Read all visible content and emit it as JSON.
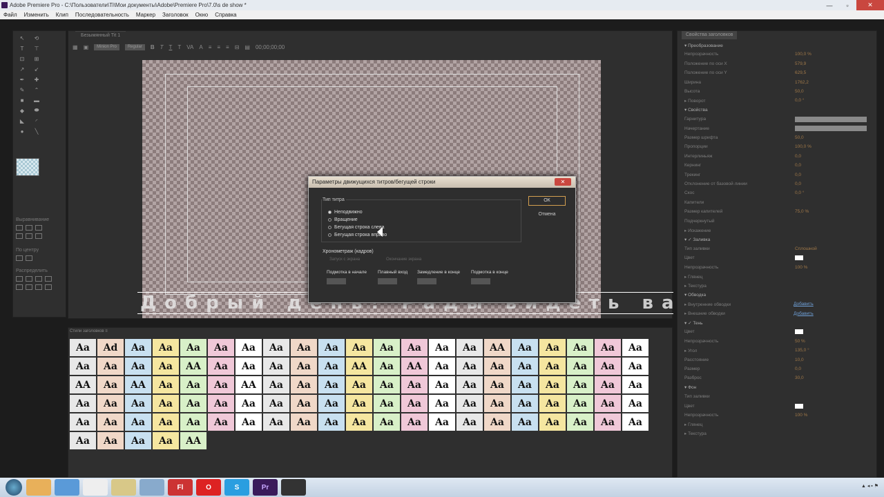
{
  "window": {
    "title": "Adobe Premiere Pro - C:\\Пользователи\\Ti\\Мои документы\\Adobe\\Premiere Pro\\7.0\\s de show *"
  },
  "menu": [
    "Файл",
    "Изменить",
    "Клип",
    "Последовательность",
    "Маркер",
    "Заголовок",
    "Окно",
    "Справка"
  ],
  "titler": {
    "tab": "Безымянный Tit 1",
    "font_box": "Minion Pro",
    "style_box": "Regular",
    "timecode": "00;00;00;00",
    "crawl_text": "Добрый день! Рады видеть вас в нашем н"
  },
  "tools_panel": {
    "align_label": "Выравнивание",
    "center_label": "По центру",
    "distribute_label": "Распределить"
  },
  "styles": {
    "tab": "Стили заголовков ≡"
  },
  "style_samples": [
    "Aa",
    "Ad",
    "Aa",
    "Aa",
    "Aa",
    "Aa",
    "Aa",
    "Aa",
    "Aa",
    "Aa",
    "Aa",
    "Aa",
    "Aa",
    "Aa",
    "Aa",
    "AA",
    "Aa",
    "Aa",
    "Aa",
    "Aa",
    "Aa",
    "Aa",
    "Aa",
    "Aa",
    "Aa",
    "AA",
    "Aa",
    "Aa",
    "Aa",
    "Aa",
    "Aa",
    "AA",
    "Aa",
    "AA",
    "Aa",
    "Aa",
    "Aa",
    "Aa",
    "Aa",
    "Aa",
    "Aa",
    "Aa",
    "AA",
    "Aa",
    "AA",
    "Aa",
    "Aa",
    "Aa",
    "AA",
    "Aa",
    "Aa",
    "Aa",
    "Aa",
    "Aa",
    "Aa",
    "Aa",
    "Aa",
    "Aa",
    "Aa",
    "Aa",
    "Aa",
    "Aa",
    "Aa",
    "Aa",
    "Aa",
    "Aa",
    "Aa",
    "Aa",
    "Aa",
    "Aa",
    "Aa",
    "Aa",
    "Aa",
    "Aa",
    "Aa",
    "Aa",
    "Aa",
    "Aa",
    "Aa",
    "Aa",
    "Aa",
    "Aa",
    "Aa",
    "Aa",
    "Aa",
    "Aa",
    "Aa",
    "Aa",
    "Aa",
    "Aa",
    "Aa",
    "Aa",
    "Aa",
    "Aa",
    "Aa",
    "Aa",
    "Aa",
    "Aa",
    "Aa",
    "Aa",
    "Aa",
    "Aa",
    "Aa",
    "Aa",
    "Aa",
    "Aa",
    "Aa",
    "Aa",
    "Aa",
    "AA"
  ],
  "properties": {
    "tab": "Свойства заголовков",
    "rows": [
      {
        "k": "▾ Преобразование",
        "v": "",
        "sec": true
      },
      {
        "k": "Непрозрачность",
        "v": "100,0 %"
      },
      {
        "k": "Положение по оси X",
        "v": "579,9"
      },
      {
        "k": "Положение по оси Y",
        "v": "629,5"
      },
      {
        "k": "Ширина",
        "v": "1762,2"
      },
      {
        "k": "Высота",
        "v": "50,0"
      },
      {
        "k": "▸ Поворот",
        "v": "0,0 °"
      },
      {
        "k": "▾ Свойства",
        "v": "",
        "sec": true
      },
      {
        "k": "Гарнитура",
        "bar": true
      },
      {
        "k": "Начертание",
        "bar": true
      },
      {
        "k": "Размер шрифта",
        "v": "50,0"
      },
      {
        "k": "Пропорции",
        "v": "100,0 %"
      },
      {
        "k": "Интерлиньяж",
        "v": "0,0"
      },
      {
        "k": "Кернинг",
        "v": "0,0"
      },
      {
        "k": "Трекинг",
        "v": "0,0"
      },
      {
        "k": "Отклонение от базовой линии",
        "v": "0,0"
      },
      {
        "k": "Скос",
        "v": "0,0 °"
      },
      {
        "k": "Капители",
        "v": ""
      },
      {
        "k": "Размер капителей",
        "v": "75,0 %"
      },
      {
        "k": "Подчеркнутый",
        "v": ""
      },
      {
        "k": "▸ Искажение",
        "v": ""
      },
      {
        "k": "▾ ✓ Заливка",
        "v": "",
        "sec": true
      },
      {
        "k": "Тип заливки",
        "v": "Сплошной"
      },
      {
        "k": "Цвет",
        "sw": true
      },
      {
        "k": "Непрозрачность",
        "v": "100 %"
      },
      {
        "k": "▸ Глянец",
        "v": ""
      },
      {
        "k": "▸ Текстура",
        "v": ""
      },
      {
        "k": "▾ Обводка",
        "v": "",
        "sec": true
      },
      {
        "k": "▸ Внутренние обводки",
        "link": "Добавить"
      },
      {
        "k": "▸ Внешние обводки",
        "link": "Добавить"
      },
      {
        "k": "▾ ✓ Тень",
        "v": "",
        "sec": true
      },
      {
        "k": "Цвет",
        "sw": true
      },
      {
        "k": "Непрозрачность",
        "v": "50 %"
      },
      {
        "k": "▸ Угол",
        "v": "135,0 °"
      },
      {
        "k": "Расстояние",
        "v": "10,0"
      },
      {
        "k": "Размер",
        "v": "0,0"
      },
      {
        "k": "Разброс",
        "v": "30,0"
      },
      {
        "k": "▾ Фон",
        "v": "",
        "sec": true
      },
      {
        "k": "Тип заливки",
        "v": ""
      },
      {
        "k": "Цвет",
        "sw": true
      },
      {
        "k": "Непрозрачность",
        "v": "100 %"
      },
      {
        "k": "▸ Глянец",
        "v": ""
      },
      {
        "k": "▸ Текстура",
        "v": ""
      }
    ]
  },
  "dialog": {
    "title": "Параметры движущихся титров/бегущей строки",
    "close": "✕",
    "group_label": "Тип титра",
    "radios": [
      "Неподвижно",
      "Вращение",
      "Бегущая строка слева",
      "Бегущая строка вправо"
    ],
    "ok": "ОК",
    "cancel": "Отмена",
    "timing_label": "Хронометраж (кадров)",
    "start_check": "Запуск с экрана",
    "end_check": "Окончание экрана",
    "cols": [
      "Подмотка в начале",
      "Плавный вход",
      "Замедление в конце",
      "Подмотка в конце"
    ]
  },
  "taskbar": {
    "items": [
      "",
      "",
      "",
      "",
      "",
      "Fl",
      "O",
      "S",
      "Pr",
      ""
    ],
    "tray": "▲ ◂ ▪ ⚑"
  }
}
